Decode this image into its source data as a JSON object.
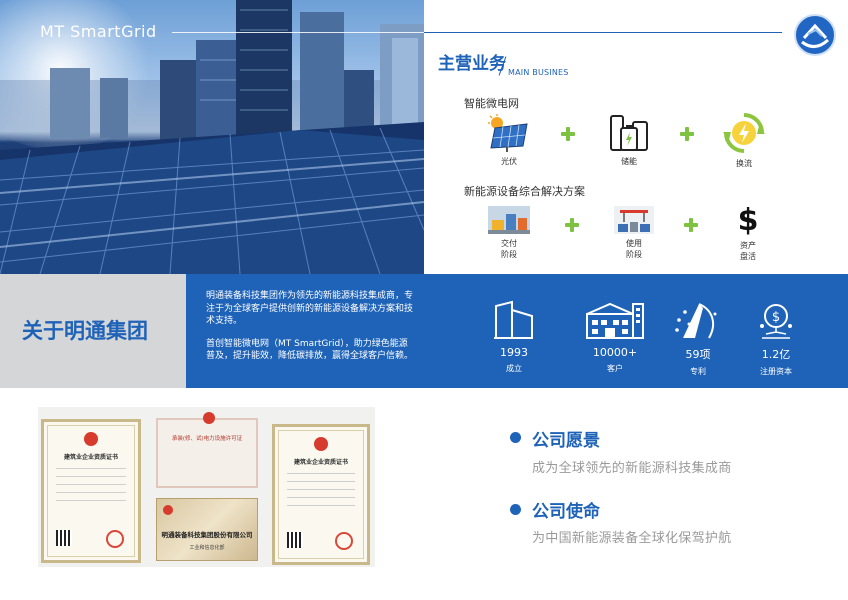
{
  "hero": {
    "title": "MT  SmartGrid"
  },
  "business": {
    "title": "主营业务",
    "subtitle": "MAIN BUSINES",
    "section1": {
      "title": "智能微电网",
      "items": [
        {
          "icon": "solar-panel-icon",
          "label": "光伏"
        },
        {
          "icon": "battery-storage-icon",
          "label": "储能"
        },
        {
          "icon": "power-exchange-icon",
          "label": "换流"
        }
      ]
    },
    "section2": {
      "title": "新能源设备综合解决方案",
      "items": [
        {
          "icon": "delivery-stage-icon",
          "label": "交付\n阶段"
        },
        {
          "icon": "usage-stage-icon",
          "label": "使用\n阶段"
        },
        {
          "icon": "dollar-icon",
          "label": "资产\n盘活"
        }
      ]
    }
  },
  "about": {
    "title": "关于明通集团",
    "para1": "明通装备科技集团作为领先的新能源科技集成商，专注于为全球客户提供创新的新能源设备解决方案和技术支持。",
    "para2": "首创智能微电网（MT SmartGrid），助力绿色能源普及，提升能效，降低碳排放，赢得全球客户信赖。",
    "stats": [
      {
        "icon": "building-icon",
        "value": "1993",
        "label": "成立"
      },
      {
        "icon": "customers-icon",
        "value": "10000+",
        "label": "客户"
      },
      {
        "icon": "patent-icon",
        "value": "59项",
        "label": "专利"
      },
      {
        "icon": "capital-icon",
        "value": "1.2亿",
        "label": "注册资本"
      }
    ]
  },
  "certificates": {
    "cert1": "建筑业企业资质证书",
    "license": "承装(修、试)电力设施许可证",
    "plaque_title": "明通装备科技集团股份有限公司",
    "plaque_sub": "工业和信息化部",
    "cert3": "建筑业企业资质证书"
  },
  "vision": {
    "title": "公司愿景",
    "text": "成为全球领先的新能源科技集成商"
  },
  "mission": {
    "title": "公司使命",
    "text": "为中国新能源装备全球化保驾护航"
  },
  "colors": {
    "primary": "#1f63b8",
    "accent": "#7ec241",
    "grey_band": "#d4d6d8"
  }
}
